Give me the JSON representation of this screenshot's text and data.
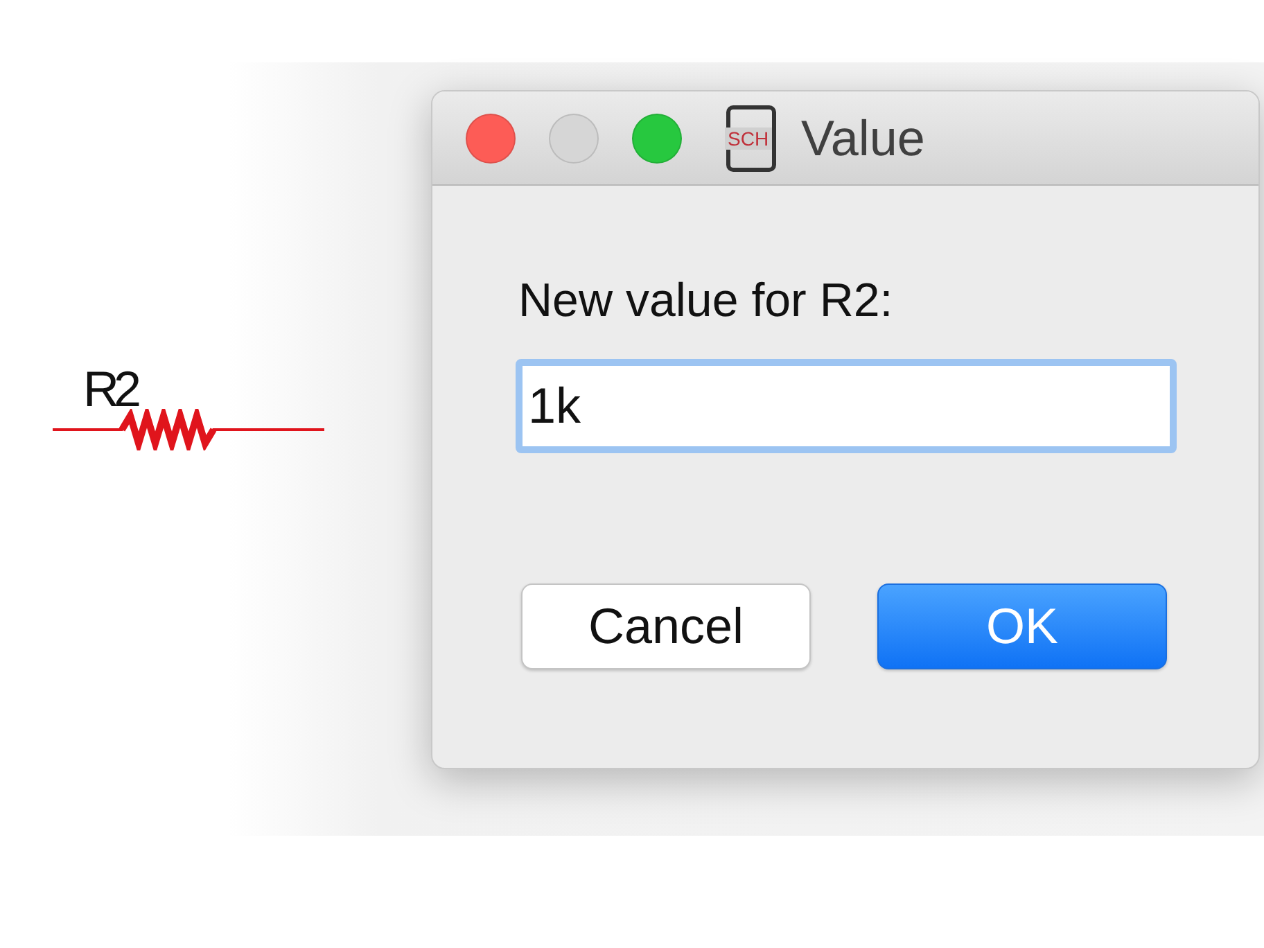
{
  "canvas": {
    "component": {
      "label": "R2"
    }
  },
  "dialog": {
    "title": "Value",
    "icon_text": "SCH",
    "window_controls": [
      {
        "kind": "close",
        "disabled": false
      },
      {
        "kind": "minimize",
        "disabled": true
      },
      {
        "kind": "zoom",
        "disabled": false
      }
    ],
    "prompt": "New value for R2:",
    "field": {
      "value": "1k",
      "focused": true
    },
    "buttons": [
      {
        "label": "Cancel",
        "default": false
      },
      {
        "label": "OK",
        "default": true
      }
    ]
  }
}
